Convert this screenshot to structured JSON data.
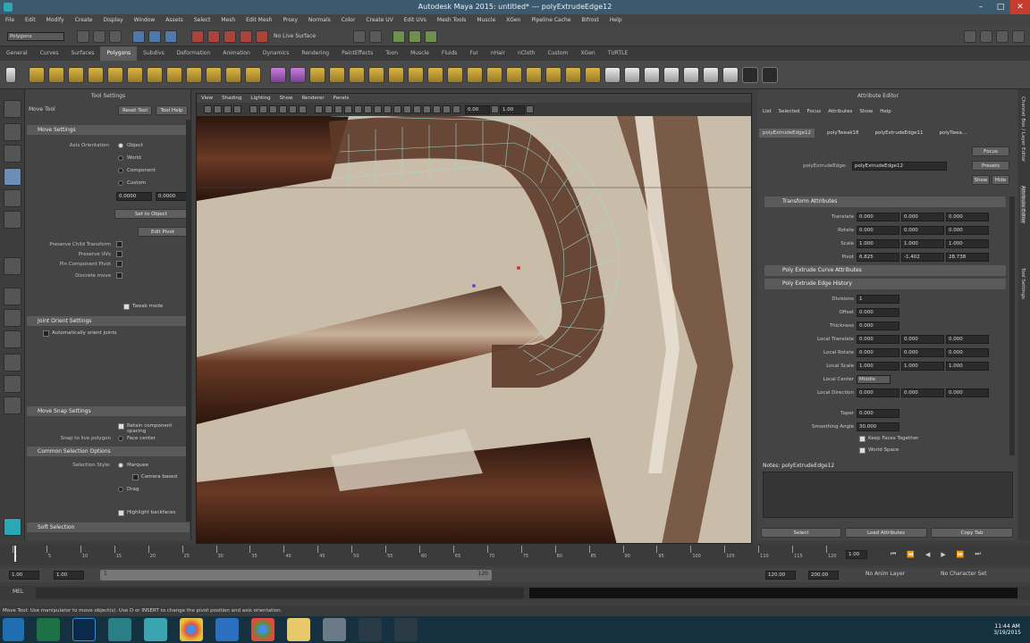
{
  "window": {
    "title": "Autodesk Maya 2015: untitled*   ---   polyExtrudeEdge12"
  },
  "menu": [
    "File",
    "Edit",
    "Modify",
    "Create",
    "Display",
    "Window",
    "Assets",
    "Select",
    "Mesh",
    "Edit Mesh",
    "Proxy",
    "Normals",
    "Color",
    "Create UV",
    "Edit UVs",
    "Mesh Tools",
    "Muscle",
    "XGen",
    "Pipeline Cache",
    "Bifrost",
    "Help"
  ],
  "statusline": {
    "mode": "Polygons",
    "live_surface": "No Live Surface"
  },
  "shelf_tabs": [
    "General",
    "Curves",
    "Surfaces",
    "Polygons",
    "Subdivs",
    "Deformation",
    "Animation",
    "Dynamics",
    "Rendering",
    "PaintEffects",
    "Toon",
    "Muscle",
    "Fluids",
    "Fur",
    "nHair",
    "nCloth",
    "Custom",
    "XGen",
    "TURTLE"
  ],
  "shelf_active": "Polygons",
  "tool_settings": {
    "title": "Tool Settings",
    "tool_name": "Move Tool",
    "reset_btn": "Reset Tool",
    "help_btn": "Tool Help",
    "move_settings": "Move Settings",
    "axis_orientation": "Axis Orientation",
    "axis_options": [
      "Object",
      "World",
      "Component",
      "Custom"
    ],
    "values": [
      "0.0000",
      "0.0000"
    ],
    "set_to_object": "Set to Object",
    "edit_pivot": "Edit Pivot",
    "preserve_child": "Preserve Child Transform",
    "preserve_uvs": "Preserve UVs",
    "pin_component": "Pin Component Pivot",
    "discrete": "Discrete move",
    "tweak_mode": "Tweak mode",
    "joint_orient": "Joint Orient Settings",
    "automatically_orient": "Automatically orient joints",
    "move_snap": "Move Snap Settings",
    "retain_spacing": "Retain component spacing",
    "snap_live": "Snap to live polygon",
    "face_center": "Face center",
    "common_sel": "Common Selection Options",
    "selection_style": "Selection Style:",
    "marquee": "Marquee",
    "camera_based": "Camera based",
    "drag": "Drag",
    "highlight_backfaces": "Highlight backfaces",
    "soft_sel": "Soft Selection"
  },
  "viewport": {
    "menu": [
      "View",
      "Shading",
      "Lighting",
      "Show",
      "Renderer",
      "Panels"
    ],
    "field_a": "0.00",
    "field_b": "1.00"
  },
  "attr_editor": {
    "title": "Attribute Editor",
    "menu": [
      "List",
      "Selected",
      "Focus",
      "Attributes",
      "Show",
      "Help"
    ],
    "tabs": [
      "polyExtrudeEdge12",
      "polyTweak18",
      "polyExtrudeEdge11",
      "polyTwea..."
    ],
    "node_label": "polyExtrudeEdge:",
    "node_value": "polyExtrudeEdge12",
    "focus": "Focus",
    "presets": "Presets",
    "show": "Show",
    "hide": "Hide",
    "transform": "Transform Attributes",
    "translate": [
      "0.000",
      "0.000",
      "0.000"
    ],
    "rotate": [
      "0.000",
      "0.000",
      "0.000"
    ],
    "scale": [
      "1.000",
      "1.000",
      "1.000"
    ],
    "pivot": [
      "6.825",
      "-1.402",
      "28.738"
    ],
    "curve_attrs": "Poly Extrude Curve Attributes",
    "edge_history": "Poly Extrude Edge History",
    "divisions": "1",
    "offset": "0.000",
    "thickness": "0.000",
    "local_translate": [
      "0.000",
      "0.000",
      "0.000"
    ],
    "local_rotate": [
      "0.000",
      "0.000",
      "0.000"
    ],
    "local_scale": [
      "1.000",
      "1.000",
      "1.000"
    ],
    "local_center": "Middle",
    "local_direction": [
      "0.000",
      "0.000",
      "0.000"
    ],
    "keep_faces": "Keep Faces Together",
    "world_space": "World Space",
    "taper": "0.000",
    "smoothing": "30.000",
    "notes": "Notes: polyExtrudeEdge12",
    "select": "Select",
    "load": "Load Attributes",
    "copy_tab": "Copy Tab"
  },
  "right_dock": [
    "Channel Box / Layer Editor",
    "Attribute Editor",
    "Tool Settings"
  ],
  "time": {
    "ticks": [
      "1",
      "5",
      "10",
      "15",
      "20",
      "25",
      "30",
      "35",
      "40",
      "45",
      "50",
      "55",
      "60",
      "65",
      "70",
      "75",
      "80",
      "85",
      "90",
      "95",
      "100",
      "105",
      "110",
      "115",
      "120"
    ],
    "current": "1.00",
    "start": "1.00",
    "start2": "1.00",
    "range_start": "1",
    "range_end": "120",
    "end1": "120.00",
    "end2": "200.00",
    "anim_layer": "No Anim Layer",
    "char_set": "No Character Set"
  },
  "cmd": {
    "label": "MEL"
  },
  "help": "Move Tool: Use manipulator to move object(s). Use D or INSERT to change the pivot position and axis orientation.",
  "taskbar": {
    "time": "11:44 AM",
    "date": "3/19/2015"
  }
}
